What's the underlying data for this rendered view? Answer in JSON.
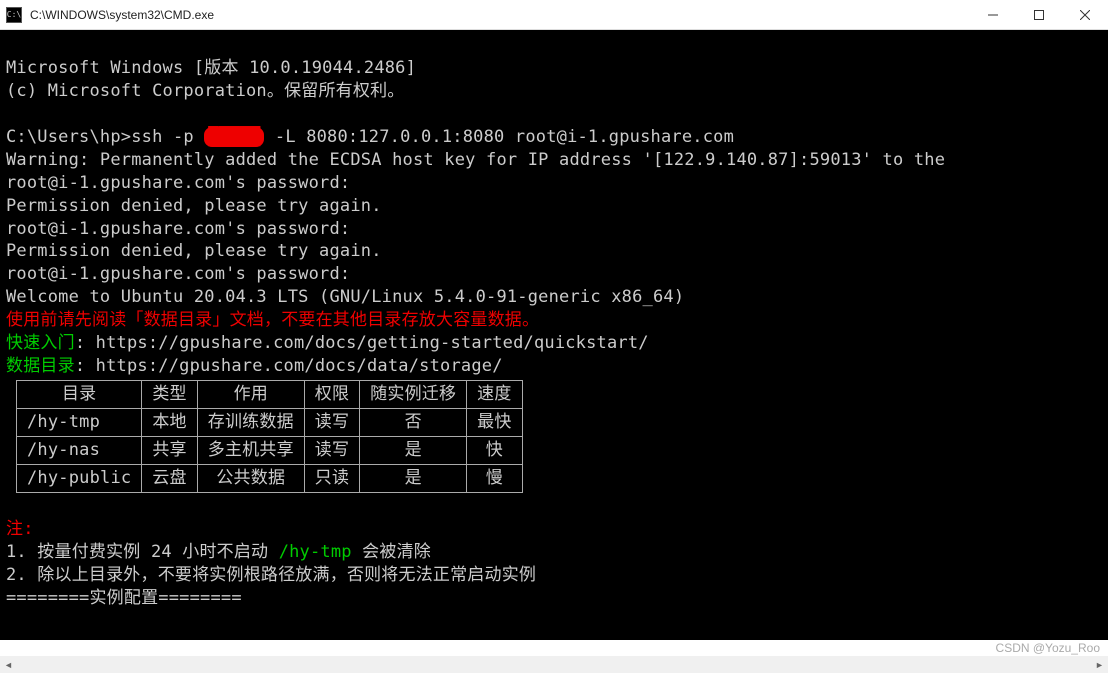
{
  "titlebar": {
    "title": "C:\\WINDOWS\\system32\\CMD.exe",
    "icon_label": "C:\\"
  },
  "terminal": {
    "line1": "Microsoft Windows [版本 10.0.19044.2486]",
    "line2": "(c) Microsoft Corporation。保留所有权利。",
    "prompt": "C:\\Users\\hp>",
    "ssh_cmd_pre": "ssh -p ",
    "ssh_censored": "█████",
    "ssh_cmd_post": " -L 8080:127.0.0.1:8080 root@i-1.gpushare.com",
    "warning": "Warning: Permanently added the ECDSA host key for IP address '[122.9.140.87]:59013' to the",
    "pw1": "root@i-1.gpushare.com's password:",
    "denied": "Permission denied, please try again.",
    "welcome": "Welcome to Ubuntu 20.04.3 LTS (GNU/Linux 5.4.0-91-generic x86_64)",
    "red_notice": "使用前请先阅读「数据目录」文档，不要在其他目录存放大容量数据。",
    "quickstart_label": "快速入门",
    "quickstart_url": ": https://gpushare.com/docs/getting-started/quickstart/",
    "storage_label": "数据目录",
    "storage_url": ": https://gpushare.com/docs/data/storage/",
    "note_header": "注:",
    "note1_pre": "1. 按量付费实例 24 小时不启动 ",
    "note1_green": "/hy-tmp",
    "note1_post": " 会被清除",
    "note2": "2. 除以上目录外，不要将实例根路径放满，否则将无法正常启动实例",
    "config_line": "========实例配置========"
  },
  "table": {
    "headers": [
      "目录",
      "类型",
      "作用",
      "权限",
      "随实例迁移",
      "速度"
    ],
    "rows": [
      [
        "/hy-tmp",
        "本地",
        "存训练数据",
        "读写",
        "否",
        "最快"
      ],
      [
        "/hy-nas",
        "共享",
        "多主机共享",
        "读写",
        "是",
        "快"
      ],
      [
        "/hy-public",
        "云盘",
        "公共数据",
        "只读",
        "是",
        "慢"
      ]
    ]
  },
  "watermark": "CSDN @Yozu_Roo"
}
